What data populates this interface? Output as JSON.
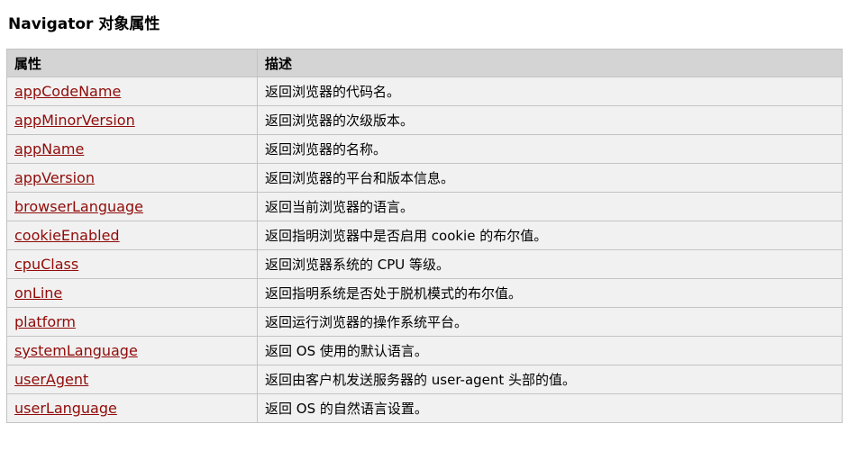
{
  "page_title": "Navigator 对象属性",
  "table": {
    "headers": [
      "属性",
      "描述"
    ],
    "rows": [
      {
        "property": "appCodeName",
        "description": "返回浏览器的代码名。"
      },
      {
        "property": "appMinorVersion",
        "description": "返回浏览器的次级版本。"
      },
      {
        "property": "appName",
        "description": "返回浏览器的名称。"
      },
      {
        "property": "appVersion",
        "description": "返回浏览器的平台和版本信息。"
      },
      {
        "property": "browserLanguage",
        "description": "返回当前浏览器的语言。"
      },
      {
        "property": "cookieEnabled",
        "description": "返回指明浏览器中是否启用  cookie 的布尔值。"
      },
      {
        "property": "cpuClass",
        "description": "返回浏览器系统的  CPU 等级。"
      },
      {
        "property": "onLine",
        "description": "返回指明系统是否处于脱机模式的布尔值。"
      },
      {
        "property": "platform",
        "description": "返回运行浏览器的操作系统平台。"
      },
      {
        "property": "systemLanguage",
        "description": "返回  OS 使用的默认语言。"
      },
      {
        "property": "userAgent",
        "description": "返回由客户机发送服务器的  user-agent 头部的值。"
      },
      {
        "property": "userLanguage",
        "description": "返回  OS 的自然语言设置。"
      }
    ]
  },
  "colors": {
    "link": "#900b09",
    "header_bg": "#d4d4d4",
    "cell_bg": "#f1f1f1",
    "border": "#c3c3c3"
  }
}
